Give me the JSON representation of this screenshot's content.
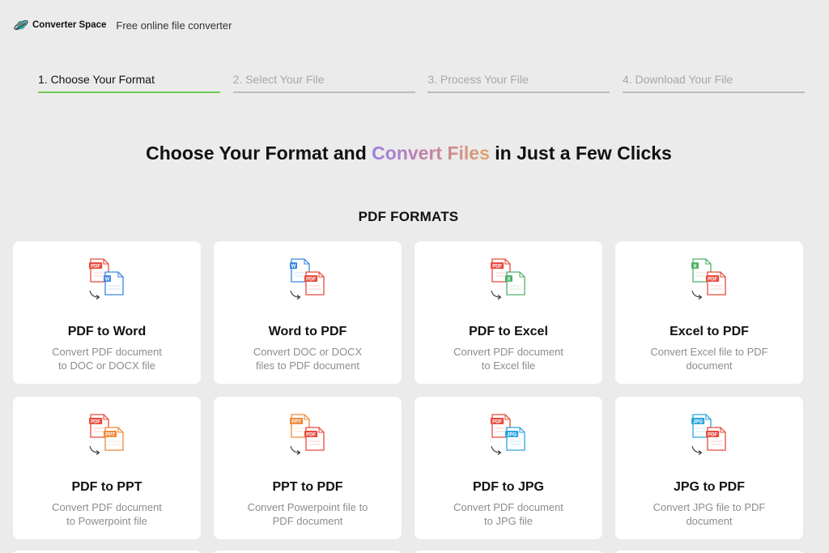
{
  "header": {
    "brand": "Converter Space",
    "tagline": "Free online file converter"
  },
  "steps": [
    {
      "label": "1. Choose Your Format",
      "active": true
    },
    {
      "label": "2. Select Your File",
      "active": false
    },
    {
      "label": "3. Process Your File",
      "active": false
    },
    {
      "label": "4. Download Your File",
      "active": false
    }
  ],
  "headline": {
    "before": "Choose Your Format and ",
    "highlight": "Convert Files",
    "after": " in Just a Few Clicks"
  },
  "section_title": "PDF FORMATS",
  "colors": {
    "pdf": "#e84a3d",
    "word": "#3a86e0",
    "excel": "#4fb26a",
    "ppt": "#ef8a3a",
    "jpg": "#2ba6de",
    "active_step": "#6fcb56"
  },
  "cards": [
    {
      "title": "PDF to Word",
      "desc": "Convert PDF document to DOC or DOCX file",
      "from": "PDF",
      "to": "W",
      "from_type": "pdf",
      "to_type": "word"
    },
    {
      "title": "Word to PDF",
      "desc": "Convert DOC or DOCX files to PDF document",
      "from": "W",
      "to": "PDF",
      "from_type": "word",
      "to_type": "pdf"
    },
    {
      "title": "PDF to Excel",
      "desc": "Convert PDF document to Excel file",
      "from": "PDF",
      "to": "X",
      "from_type": "pdf",
      "to_type": "excel"
    },
    {
      "title": "Excel to PDF",
      "desc": "Convert Excel file to PDF document",
      "from": "X",
      "to": "PDF",
      "from_type": "excel",
      "to_type": "pdf"
    },
    {
      "title": "PDF to PPT",
      "desc": "Convert PDF document to Powerpoint file",
      "from": "PDF",
      "to": "PPT",
      "from_type": "pdf",
      "to_type": "ppt"
    },
    {
      "title": "PPT to PDF",
      "desc": "Convert Powerpoint file to PDF document",
      "from": "PPT",
      "to": "PDF",
      "from_type": "ppt",
      "to_type": "pdf"
    },
    {
      "title": "PDF to JPG",
      "desc": "Convert PDF document to JPG file",
      "from": "PDF",
      "to": "JPG",
      "from_type": "pdf",
      "to_type": "jpg"
    },
    {
      "title": "JPG to PDF",
      "desc": "Convert JPG file to PDF document",
      "from": "JPG",
      "to": "PDF",
      "from_type": "jpg",
      "to_type": "pdf"
    }
  ]
}
